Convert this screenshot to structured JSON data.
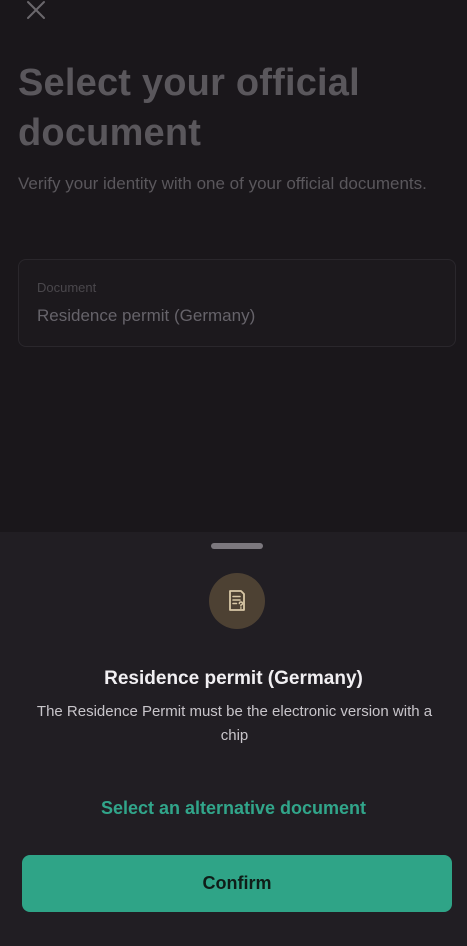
{
  "header": {
    "close_icon": "close-icon",
    "title": "Select your official document",
    "subtitle": "Verify your identity with one of your official documents."
  },
  "document_field": {
    "label": "Document",
    "value": "Residence permit (Germany)"
  },
  "sheet": {
    "icon": "document-question-icon",
    "title": "Residence permit (Germany)",
    "description": "The Residence Permit must be the electronic version with a chip",
    "alternative_link": "Select an alternative document",
    "confirm_label": "Confirm"
  },
  "colors": {
    "background": "#1a171b",
    "sheet_background": "#211e23",
    "accent": "#2fa487",
    "icon_circle": "#4d4133",
    "icon_stroke": "#d8c7a6"
  }
}
